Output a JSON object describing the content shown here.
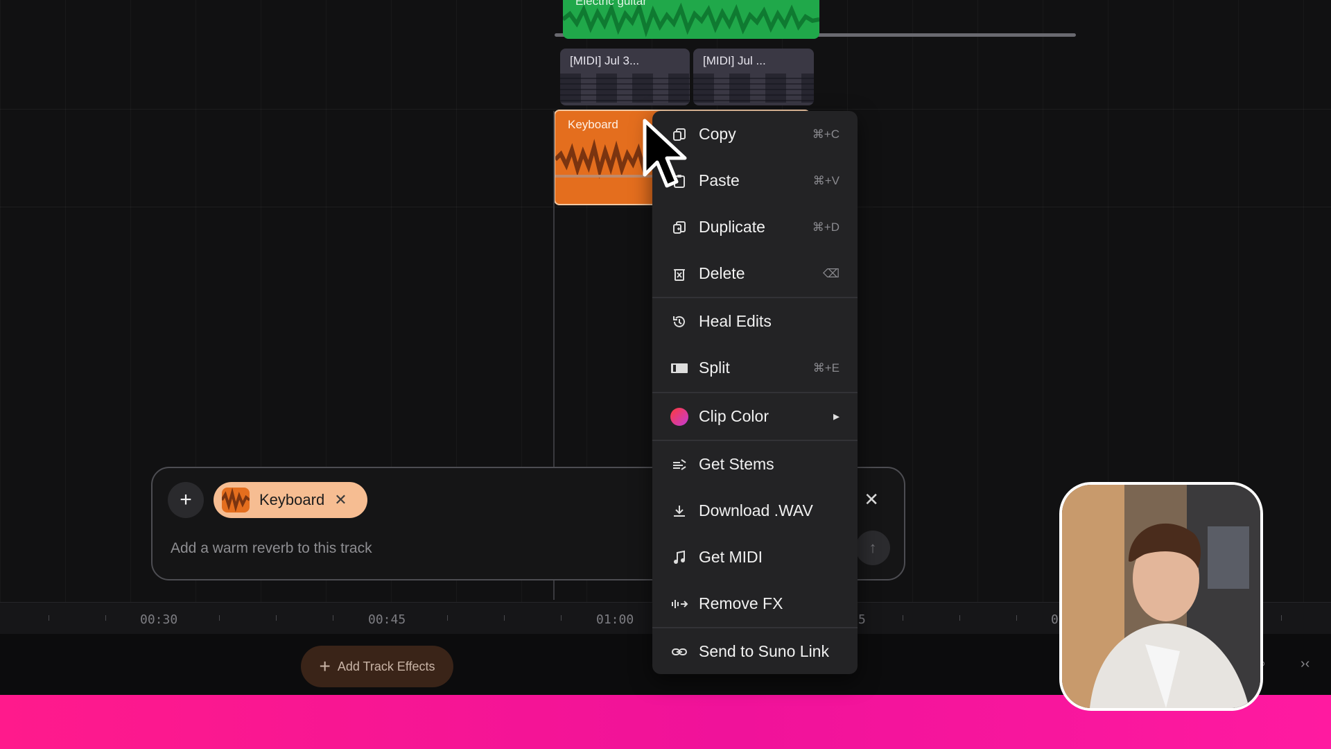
{
  "tracks": {
    "green_clip_label": "Electric guitar",
    "midi_clips": [
      "[MIDI] Jul 3...",
      "[MIDI] Jul ..."
    ],
    "orange_clip_label": "Keyboard"
  },
  "ruler": {
    "times": [
      "00:30",
      "00:45",
      "01:00",
      "5",
      "0"
    ]
  },
  "prompt_box": {
    "chip_label": "Keyboard",
    "placeholder": "Add a warm reverb to this track"
  },
  "context_menu": {
    "items": [
      {
        "label": "Copy",
        "shortcut": "⌘+C",
        "icon": "copy-icon"
      },
      {
        "label": "Paste",
        "shortcut": "⌘+V",
        "icon": "paste-icon"
      },
      {
        "label": "Duplicate",
        "shortcut": "⌘+D",
        "icon": "duplicate-icon"
      },
      {
        "label": "Delete",
        "shortcut": "⌫",
        "icon": "trash-icon"
      },
      {
        "label": "Heal Edits",
        "shortcut": "",
        "icon": "history-icon"
      },
      {
        "label": "Split",
        "shortcut": "⌘+E",
        "icon": "split-icon"
      },
      {
        "label": "Clip Color",
        "shortcut": "▸",
        "icon": "color-dot-icon"
      },
      {
        "label": "Get Stems",
        "shortcut": "",
        "icon": "stems-icon"
      },
      {
        "label": "Download .WAV",
        "shortcut": "",
        "icon": "download-icon"
      },
      {
        "label": "Get MIDI",
        "shortcut": "",
        "icon": "music-note-icon"
      },
      {
        "label": "Remove FX",
        "shortcut": "",
        "icon": "remove-fx-icon"
      },
      {
        "label": "Send to Suno Link",
        "shortcut": "",
        "icon": "link-icon"
      }
    ]
  },
  "bottom": {
    "add_track_effects": "Add Track Effects"
  },
  "colors": {
    "orange_clip": "#e46e1e",
    "green_clip": "#20a84a",
    "pink_bar": "#f0129a",
    "menu_bg": "#232325"
  }
}
